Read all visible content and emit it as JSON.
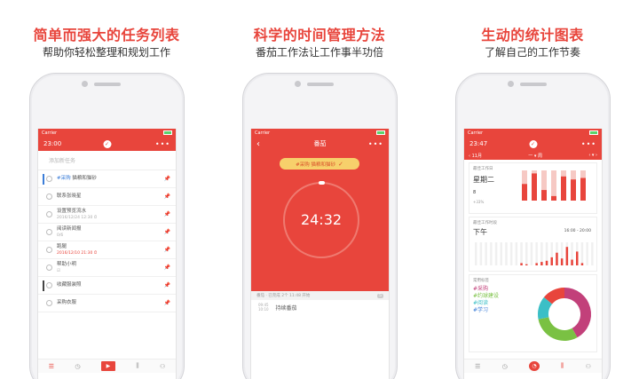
{
  "panels": [
    {
      "headline": "简单而强大的任务列表",
      "subline": "帮助你轻松整理和规划工作"
    },
    {
      "headline": "科学的时间管理方法",
      "subline": "番茄工作法让工作事半功倍"
    },
    {
      "headline": "生动的统计图表",
      "subline": "了解自己的工作节奏"
    }
  ],
  "colors": {
    "accent": "#e8453c",
    "pill": "#f7d06b",
    "blue": "#3b7dd8",
    "green": "#7ac143",
    "teal": "#3bbfc6",
    "purple": "#c2407a"
  },
  "screen1": {
    "status_left": "Carrier",
    "time": "23:00",
    "more": "•••",
    "add_placeholder": "添加新任务",
    "tasks": [
      {
        "tag": "#采购",
        "title": "猫粮和猫砂",
        "sub": "",
        "pinned": true,
        "mark": "blue"
      },
      {
        "tag": "",
        "title": "联系张晓星",
        "sub": "",
        "pinned": false,
        "mark": ""
      },
      {
        "tag": "",
        "title": "设置预览流水",
        "sub": "2016/12/24 12:30 ⏱",
        "pinned": false,
        "mark": ""
      },
      {
        "tag": "",
        "title": "阅读新闻报",
        "sub": "0/6",
        "pinned": false,
        "mark": ""
      },
      {
        "tag": "",
        "title": "跑腿",
        "sub": "2016/12/10 21:30 ⏱",
        "pinned": false,
        "mark": "",
        "sub_red": true
      },
      {
        "tag": "",
        "title": "帮助小明",
        "sub": "☑",
        "pinned": false,
        "mark": ""
      },
      {
        "tag": "",
        "title": "收藏服装照",
        "sub": "",
        "pinned": false,
        "mark": "dark"
      },
      {
        "tag": "",
        "title": "采购衣服",
        "sub": "",
        "pinned": false,
        "mark": ""
      }
    ],
    "tabs": [
      "☰",
      "◷",
      "▶",
      "⫼",
      "⚇"
    ]
  },
  "screen2": {
    "status_left": "Carrier",
    "title": "番茄",
    "back": "‹",
    "more": "•••",
    "task_pill": "#采购 猫粮和猫砂",
    "check": "✓",
    "timer": "24:32",
    "log_head": "番茄 · 已完成 2个 11:48 开始",
    "log_badge": "5",
    "log_times": [
      "09:45",
      "10:10"
    ],
    "log_item": "持续番茄"
  },
  "screen3": {
    "status_left": "Carrier",
    "time": "23:47",
    "subnav_left": "‹ 11月",
    "subnav_mid": "一 ▾ 周",
    "subnav_right": "‹ ▾ ›",
    "card1": {
      "title": "最佳工作日",
      "day": "星期二",
      "count": "8",
      "pct": "+33%"
    },
    "card2": {
      "title": "最佳工作时段",
      "label": "下午",
      "range": "16:00 - 20:00"
    },
    "card3": {
      "title": "常用标签",
      "tags": [
        "#采购",
        "#约球建设",
        "#阅读",
        "#学习"
      ]
    },
    "tabs": [
      "☰",
      "◷",
      "◔",
      "⫼",
      "⚇"
    ]
  }
}
